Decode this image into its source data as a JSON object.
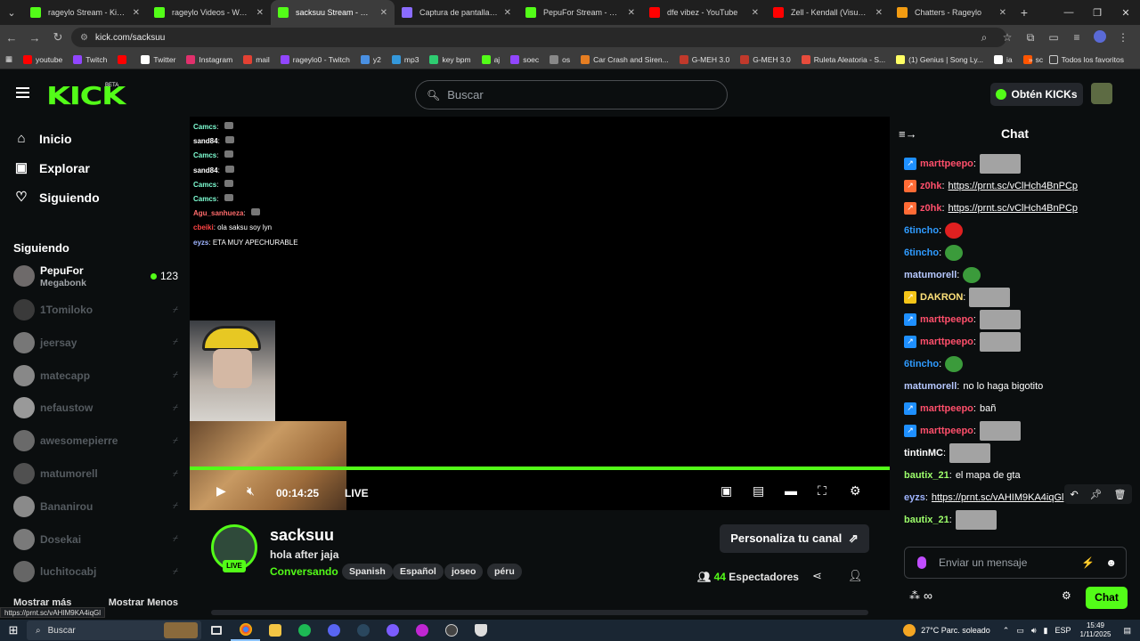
{
  "browser": {
    "tabs": [
      {
        "title": "rageylo Stream - Kick Da",
        "color": "#53fc18",
        "active": false
      },
      {
        "title": "rageylo Videos - Watch C",
        "color": "#53fc18",
        "active": false
      },
      {
        "title": "sacksuu Stream - Watch L",
        "color": "#53fc18",
        "active": true
      },
      {
        "title": "Captura de pantalla por L",
        "color": "#8b6cff",
        "active": false
      },
      {
        "title": "PepuFor Stream - Watch L",
        "color": "#53fc18",
        "active": false
      },
      {
        "title": "dfe vibez - YouTube",
        "color": "#ff0000",
        "active": false
      },
      {
        "title": "Zell - Kendall (Visualizer)",
        "color": "#ff0000",
        "active": false
      },
      {
        "title": "Chatters - Rageylo",
        "color": "#f39c12",
        "active": false
      }
    ],
    "url": "kick.com/sacksuu",
    "bookmarks": [
      {
        "label": "youtube",
        "color": "#ff0000"
      },
      {
        "label": "Twitch",
        "color": "#9146ff"
      },
      {
        "label": "",
        "color": "#ff0000"
      },
      {
        "label": "Twitter",
        "color": "#ffffff"
      },
      {
        "label": "Instagram",
        "color": "#e1306c"
      },
      {
        "label": "mail",
        "color": "#e34133"
      },
      {
        "label": "rageylo0 - Twitch",
        "color": "#9146ff"
      },
      {
        "label": "y2",
        "color": "#4a90e2"
      },
      {
        "label": "mp3",
        "color": "#3498db"
      },
      {
        "label": "key bpm",
        "color": "#2ecc71"
      },
      {
        "label": "aj",
        "color": "#53fc18"
      },
      {
        "label": "soec",
        "color": "#9146ff"
      },
      {
        "label": "os",
        "color": "#888888"
      },
      {
        "label": "Car Crash and Siren...",
        "color": "#e67e22"
      },
      {
        "label": "G-MEH 3.0",
        "color": "#c0392b"
      },
      {
        "label": "G-MEH 3.0",
        "color": "#c0392b"
      },
      {
        "label": "Ruleta Aleatoria - S...",
        "color": "#e74c3c"
      },
      {
        "label": "(1) Genius | Song Ly...",
        "color": "#ffff64"
      },
      {
        "label": "ia",
        "color": "#ffffff"
      },
      {
        "label": "sc",
        "color": "#ff5500"
      }
    ],
    "bookmarks_all": "Todos los favoritos"
  },
  "header": {
    "logo": "KICK",
    "logo_beta": "BETA",
    "search_placeholder": "Buscar",
    "kicks_button": "Obtén KICKs"
  },
  "sidebar": {
    "nav": [
      {
        "label": "Inicio",
        "icon": "home-icon",
        "glyph": "⌂"
      },
      {
        "label": "Explorar",
        "icon": "explore-icon",
        "glyph": "▣"
      },
      {
        "label": "Siguiendo",
        "icon": "heart-icon",
        "glyph": "♡"
      }
    ],
    "following_title": "Siguiendo",
    "following": [
      {
        "name": "PepuFor",
        "sub": "Megabonk",
        "live": true,
        "viewers": "123",
        "color": "#6e6a6a"
      },
      {
        "name": "1Tomiloko",
        "live": false,
        "color": "#3a3a3a"
      },
      {
        "name": "jeersay",
        "live": false,
        "color": "#777777"
      },
      {
        "name": "matecapp",
        "live": false,
        "color": "#888888"
      },
      {
        "name": "nefaustow",
        "live": false,
        "color": "#999999"
      },
      {
        "name": "awesomepierre",
        "live": false,
        "color": "#6a6a6a"
      },
      {
        "name": "matumorell",
        "live": false,
        "color": "#505050"
      },
      {
        "name": "Bananirou",
        "live": false,
        "color": "#8a8a8a"
      },
      {
        "name": "Dosekai",
        "live": false,
        "color": "#7a7a7a"
      },
      {
        "name": "luchitocabj",
        "live": false,
        "color": "#666666"
      }
    ],
    "show_more": "Mostrar más",
    "show_less": "Mostrar Menos"
  },
  "player": {
    "overlay_chat": [
      {
        "user": "Camcs",
        "color": "#7fffd4",
        "text": ""
      },
      {
        "user": "sand84",
        "color": "#ffffff",
        "text": ""
      },
      {
        "user": "Camcs",
        "color": "#7fffd4",
        "text": ""
      },
      {
        "user": "sand84",
        "color": "#ffffff",
        "text": ""
      },
      {
        "user": "Camcs",
        "color": "#7fffd4",
        "text": ""
      },
      {
        "user": "Camcs",
        "color": "#7fffd4",
        "text": ""
      },
      {
        "user": "Agu_sanhueza",
        "color": "#ff6b6b",
        "text": ""
      },
      {
        "user": "cbeiki",
        "color": "#ff4444",
        "text": "ola saksu soy lyn"
      },
      {
        "user": "eyzs",
        "color": "#9fb4ff",
        "text": "ETA MUY APECHURABLE"
      }
    ],
    "time": "00:14:25",
    "live_label": "LIVE",
    "progress_pct": 100
  },
  "stream": {
    "name": "sacksuu",
    "title": "hola after jaja",
    "category": "Conversando",
    "live_badge": "LIVE",
    "tags": [
      "Spanish",
      "Español",
      "joseo",
      "péru"
    ],
    "customize_button": "Personaliza tu canal",
    "viewers": "44",
    "viewers_label": "Espectadores"
  },
  "chat": {
    "title": "Chat",
    "messages": [
      {
        "user": "marttpeepo",
        "color": "#ff4f6b",
        "badge": "#1e90ff",
        "kind": "img",
        "text": ""
      },
      {
        "user": "z0hk",
        "color": "#ff4f6b",
        "badge": "#ff6b35",
        "kind": "link",
        "text": "https://prnt.sc/vClHch4BnPCp"
      },
      {
        "user": "z0hk",
        "color": "#ff4f6b",
        "badge": "#ff6b35",
        "kind": "link",
        "text": "https://prnt.sc/vClHch4BnPCp"
      },
      {
        "user": "6tincho",
        "color": "#2f9bff",
        "badge": "",
        "kind": "emote",
        "emote": "#e02020",
        "text": ""
      },
      {
        "user": "6tincho",
        "color": "#2f9bff",
        "badge": "",
        "kind": "emote",
        "emote": "#3b9b3b",
        "text": ""
      },
      {
        "user": "matumorell",
        "color": "#b6c8ff",
        "badge": "",
        "kind": "emote",
        "emote": "#3b9b3b",
        "text": ""
      },
      {
        "user": "DAKRON",
        "color": "#ffe27a",
        "badge": "#f5c518",
        "kind": "img",
        "text": ""
      },
      {
        "user": "marttpeepo",
        "color": "#ff4f6b",
        "badge": "#1e90ff",
        "kind": "img",
        "text": ""
      },
      {
        "user": "marttpeepo",
        "color": "#ff4f6b",
        "badge": "#1e90ff",
        "kind": "img",
        "text": ""
      },
      {
        "user": "6tincho",
        "color": "#2f9bff",
        "badge": "",
        "kind": "emote",
        "emote": "#3b9b3b",
        "text": ""
      },
      {
        "user": "matumorell",
        "color": "#b6c8ff",
        "badge": "",
        "kind": "text",
        "text": "no lo haga bigotito"
      },
      {
        "user": "marttpeepo",
        "color": "#ff4f6b",
        "badge": "#1e90ff",
        "kind": "text",
        "text": "bañ"
      },
      {
        "user": "marttpeepo",
        "color": "#ff4f6b",
        "badge": "#1e90ff",
        "kind": "img",
        "text": ""
      },
      {
        "user": "tintinMC",
        "color": "#ffffff",
        "badge": "",
        "kind": "img",
        "text": ""
      },
      {
        "user": "bautix_21",
        "color": "#9dff6b",
        "badge": "",
        "kind": "text",
        "text": "el mapa de gta"
      },
      {
        "user": "eyzs",
        "color": "#9fb4ff",
        "badge": "",
        "kind": "link",
        "text": "https://prnt.sc/vAHIM9KA4iqGl"
      },
      {
        "user": "bautix_21",
        "color": "#9dff6b",
        "badge": "",
        "kind": "img",
        "text": ""
      }
    ],
    "input_placeholder": "Enviar un mensaje",
    "send_button": "Chat"
  },
  "status_link": "https://prnt.sc/vAHIM9KA4iqGl",
  "taskbar": {
    "search": "Buscar",
    "weather": "27°C  Parc. soleado",
    "lang": "ESP",
    "time": "15:49",
    "date": "1/11/2025"
  }
}
